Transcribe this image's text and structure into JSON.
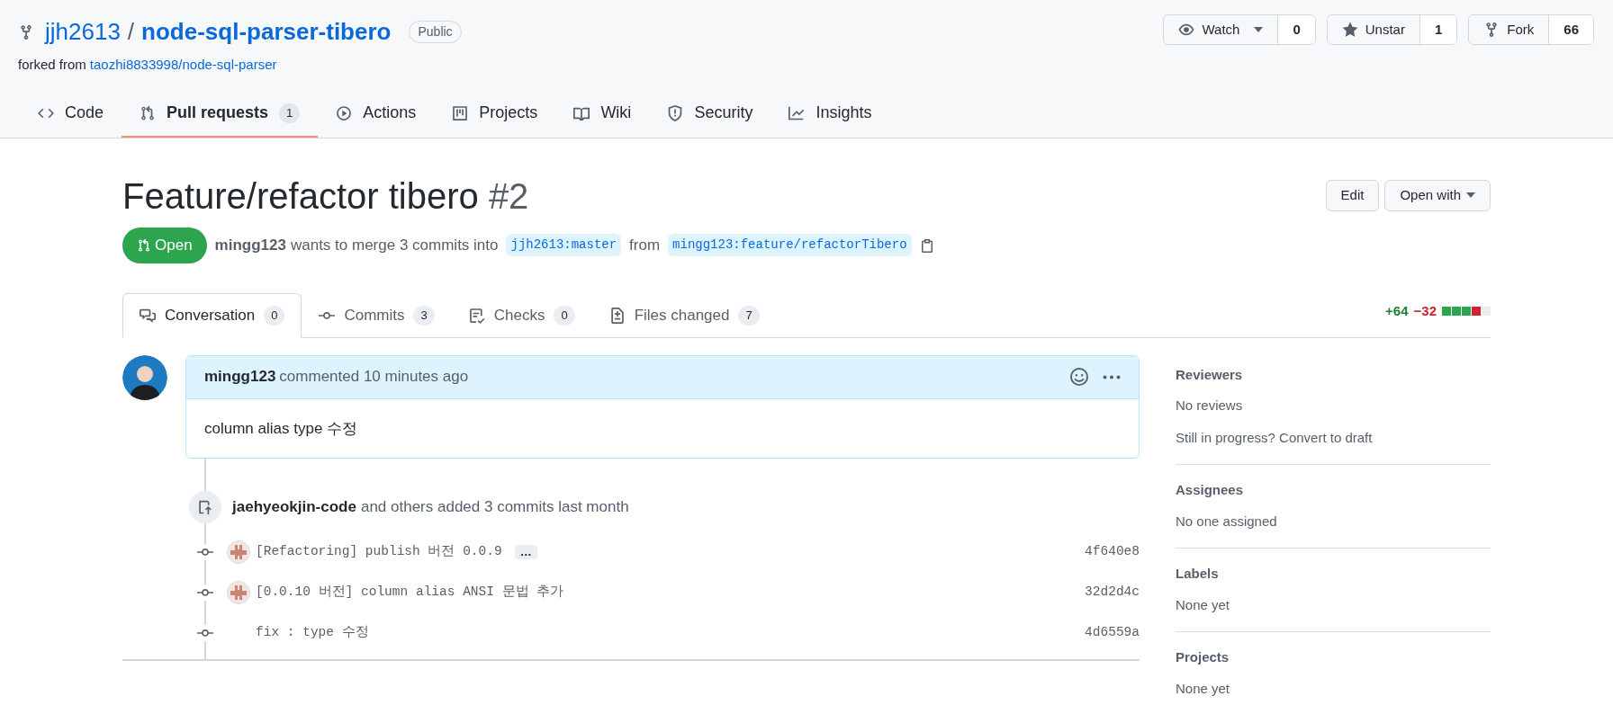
{
  "repo": {
    "owner": "jjh2613",
    "separator": "/",
    "name": "node-sql-parser-tibero",
    "visibility": "Public",
    "forked_from_label": "forked from",
    "forked_from": "taozhi8833998/node-sql-parser"
  },
  "repo_actions": [
    {
      "kind": "watch",
      "label": "Watch",
      "count": "0",
      "dropdown": true
    },
    {
      "kind": "star",
      "label": "Unstar",
      "count": "1",
      "dropdown": false
    },
    {
      "kind": "fork",
      "label": "Fork",
      "count": "66",
      "dropdown": false
    }
  ],
  "repo_tabs": [
    {
      "kind": "code",
      "label": "Code",
      "selected": false
    },
    {
      "kind": "pull",
      "label": "Pull requests",
      "count": "1",
      "selected": true
    },
    {
      "kind": "play",
      "label": "Actions",
      "selected": false
    },
    {
      "kind": "board",
      "label": "Projects",
      "selected": false
    },
    {
      "kind": "book",
      "label": "Wiki",
      "selected": false
    },
    {
      "kind": "shield",
      "label": "Security",
      "selected": false
    },
    {
      "kind": "graph",
      "label": "Insights",
      "selected": false
    }
  ],
  "pull_request": {
    "title": "Feature/refactor tibero",
    "number": "#2",
    "state": {
      "label": "Open",
      "kind": "open"
    },
    "author": "mingg123",
    "summary": "wants to merge 3 commits into",
    "base": "jjh2613:master",
    "from": "from",
    "head": "mingg123:feature/refactorTibero"
  },
  "header_buttons": [
    {
      "label": "Edit",
      "dropdown": false
    },
    {
      "label": "Open with",
      "dropdown": true
    }
  ],
  "pr_tabs": [
    {
      "kind": "comment",
      "label": "Conversation",
      "count": "0",
      "selected": true
    },
    {
      "kind": "commit",
      "label": "Commits",
      "count": "3",
      "selected": false
    },
    {
      "kind": "checklist",
      "label": "Checks",
      "count": "0",
      "selected": false
    },
    {
      "kind": "diff",
      "label": "Files changed",
      "count": "7",
      "selected": false
    }
  ],
  "diff_stats": {
    "additions": "+64",
    "deletions": "−32",
    "blocks": [
      {
        "color": "#2da44e"
      },
      {
        "color": "#2da44e"
      },
      {
        "color": "#2da44e"
      },
      {
        "color": "#cf222e"
      },
      {
        "color": "#eaeef2"
      }
    ]
  },
  "comment": {
    "author": "mingg123",
    "action": "commented 10 minutes ago",
    "body": "column alias type 수정"
  },
  "commit_event": {
    "author": "jaehyeokjin-code",
    "summary": "and others added 3 commits last month"
  },
  "commits": [
    {
      "message": "[Refactoring] publish 버전 0.0.9",
      "avatar": {
        "kind": "identicon"
      },
      "expand_label": "…",
      "sha": "4f640e8"
    },
    {
      "message": "[0.0.10 버전] column alias ANSI 문법 추가",
      "avatar": {
        "kind": "identicon"
      },
      "sha": "32d2d4c"
    },
    {
      "message": "fix : type 수정",
      "sha": "4d6559a"
    }
  ],
  "sidebar": [
    {
      "heading": "Reviewers",
      "lines": [
        "No reviews",
        "Still in progress? Convert to draft"
      ]
    },
    {
      "heading": "Assignees",
      "lines": [
        "No one assigned"
      ]
    },
    {
      "heading": "Labels",
      "lines": [
        "None yet"
      ]
    },
    {
      "heading": "Projects",
      "lines": [
        "None yet"
      ]
    }
  ]
}
